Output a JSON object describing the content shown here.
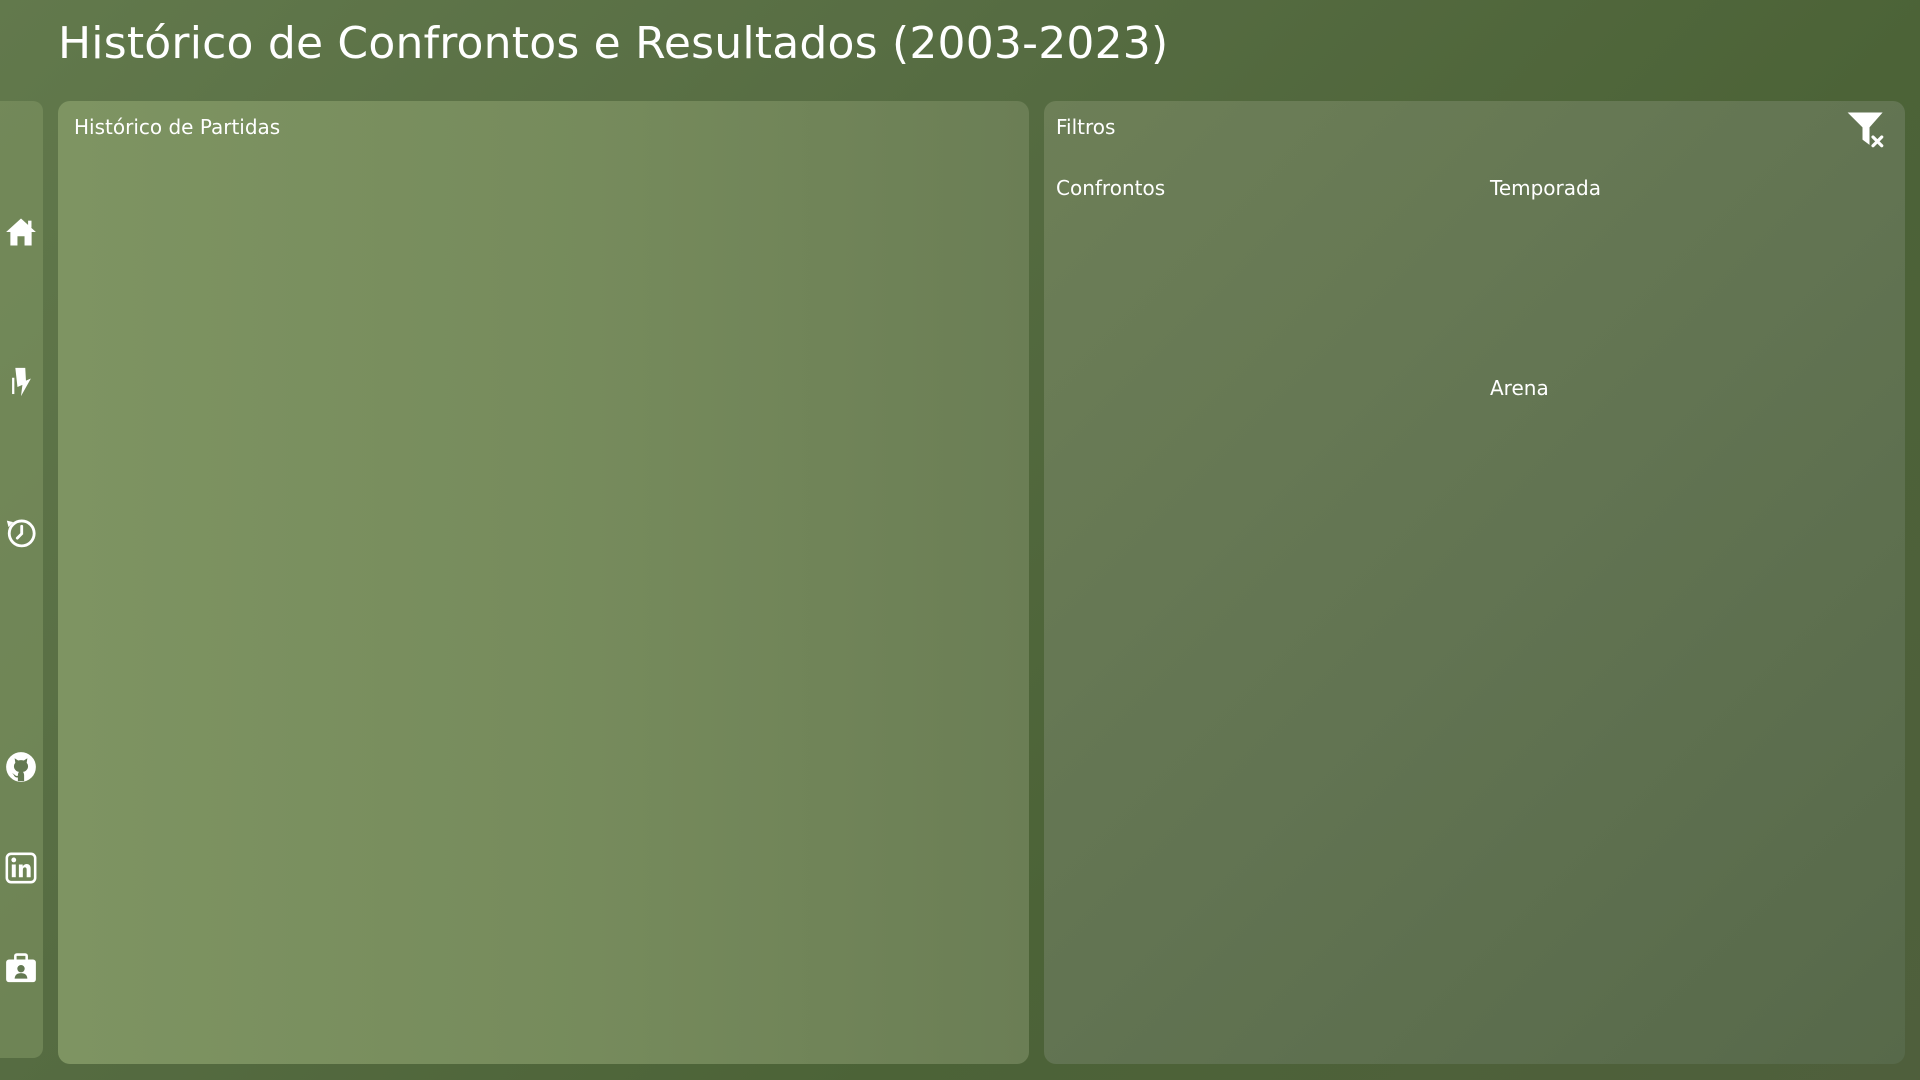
{
  "header": {
    "title": "Histórico de Confrontos e Resultados (2003-2023)"
  },
  "sidebar": {
    "items": [
      {
        "icon": "home-icon"
      },
      {
        "icon": "fire-icon"
      },
      {
        "icon": "history-clock-icon"
      },
      {
        "icon": "github-icon"
      },
      {
        "icon": "linkedin-icon"
      },
      {
        "icon": "portfolio-icon"
      }
    ]
  },
  "history_panel": {
    "title": "Histórico de Partidas"
  },
  "filters_panel": {
    "title": "Filtros",
    "clear_icon": "clear-filter-icon",
    "labels": {
      "matchups": "Confrontos",
      "season": "Temporada",
      "arena": "Arena"
    }
  },
  "colors": {
    "background": "#566c42",
    "panel_light": "#7e9462",
    "panel_dark": "#5e704d",
    "text": "#ffffff"
  }
}
